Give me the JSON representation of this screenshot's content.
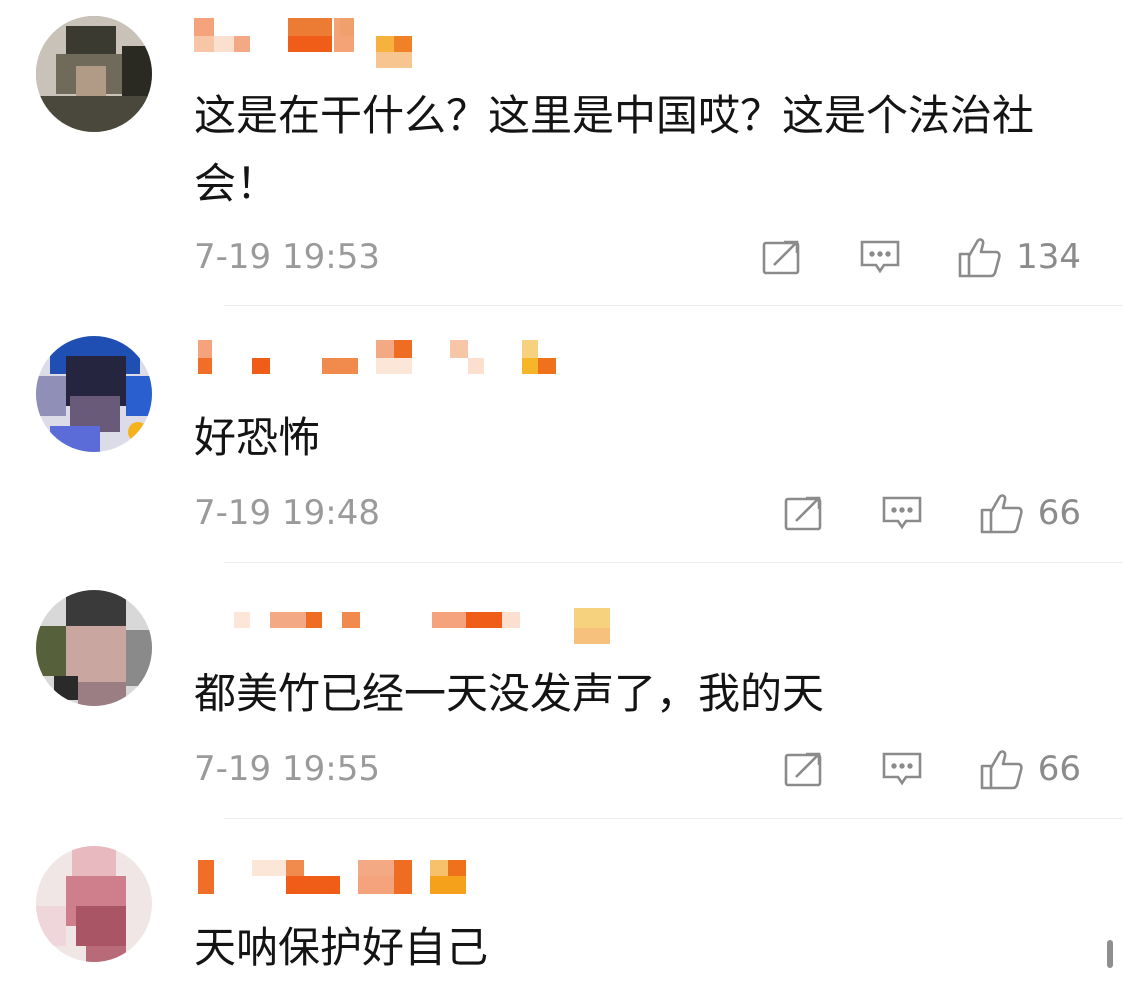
{
  "comments": [
    {
      "text": "这是在干什么？这里是中国哎？这是个法治社会！",
      "time": "7-19 19:53",
      "likes": "134"
    },
    {
      "text": "好恐怖",
      "time": "7-19 19:48",
      "likes": "66"
    },
    {
      "text": "都美竹已经一天没发声了，我的天",
      "time": "7-19 19:55",
      "likes": "66"
    },
    {
      "text": "天呐保护好自己",
      "time": "",
      "likes": ""
    }
  ],
  "icons": {
    "share": "share-icon",
    "comment": "comment-icon",
    "like": "thumbs-up-icon"
  },
  "colors": {
    "text": "#141414",
    "meta": "#9a9a9a",
    "divider": "#ececec",
    "name_accent": "#f07d1a"
  }
}
